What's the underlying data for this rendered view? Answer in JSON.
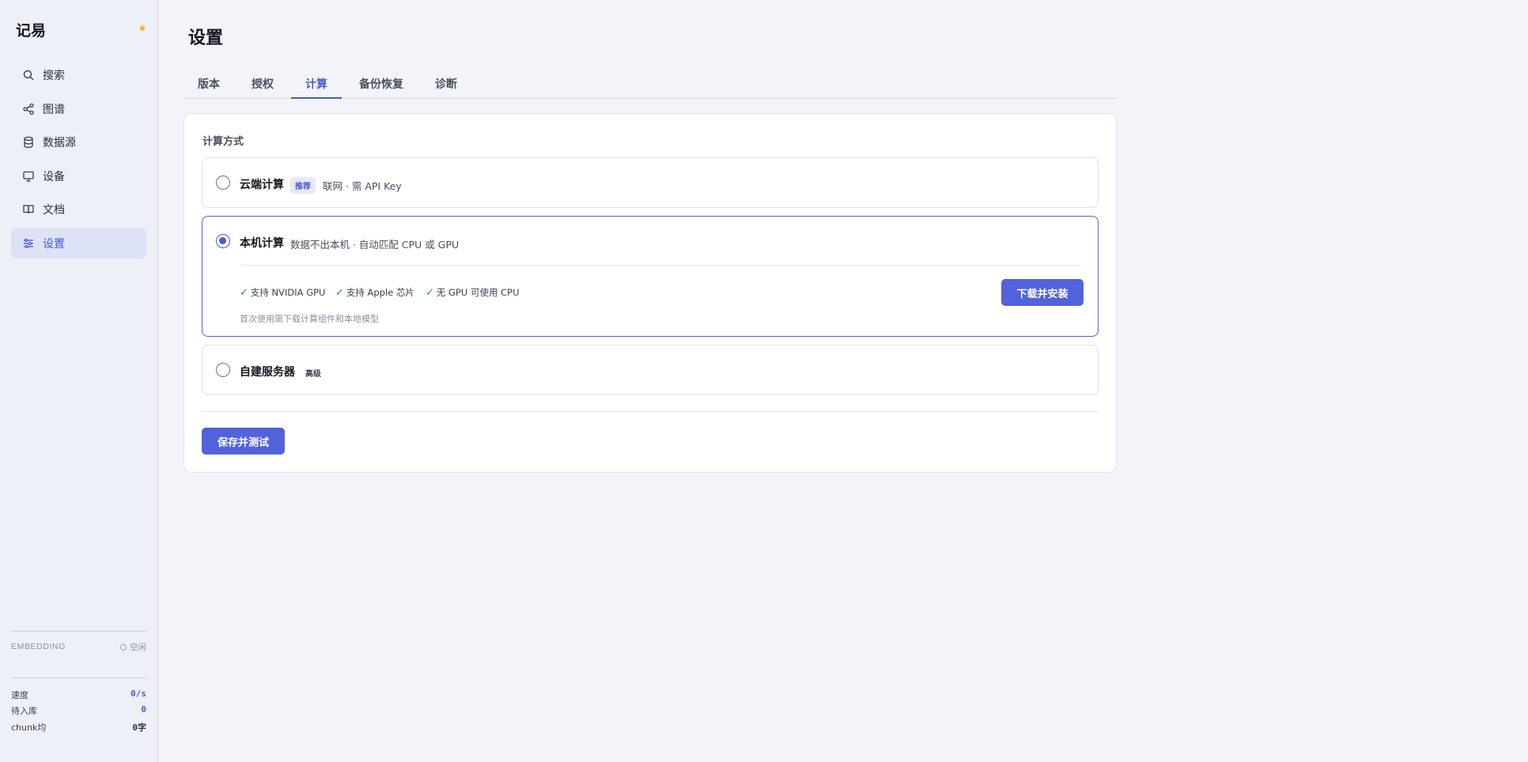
{
  "sidebar": {
    "brand": "记易",
    "items": [
      {
        "label": "搜索",
        "icon": "search-icon"
      },
      {
        "label": "图谱",
        "icon": "graph-icon"
      },
      {
        "label": "数据源",
        "icon": "database-icon"
      },
      {
        "label": "设备",
        "icon": "monitor-icon"
      },
      {
        "label": "文档",
        "icon": "book-icon"
      },
      {
        "label": "设置",
        "icon": "sliders-icon",
        "active": true
      }
    ],
    "embedding_label": "EMBEDDING",
    "embedding_status": "空闲",
    "stats": [
      {
        "label": "速度",
        "value": "0/s"
      },
      {
        "label": "待入库",
        "value": "0"
      },
      {
        "label": "chunk均",
        "value": "0字"
      }
    ]
  },
  "main": {
    "title": "设置",
    "tabs": [
      {
        "label": "版本"
      },
      {
        "label": "授权"
      },
      {
        "label": "计算",
        "active": true
      },
      {
        "label": "备份恢复"
      },
      {
        "label": "诊断"
      }
    ],
    "section_label": "计算方式",
    "options": {
      "cloud": {
        "title": "云端计算",
        "badge": "推荐",
        "desc": "联网 · 需 API Key"
      },
      "local": {
        "title": "本机计算",
        "desc": "数据不出本机 · 自动匹配 CPU 或 GPU",
        "features": [
          "支持 NVIDIA GPU",
          "支持 Apple 芯片",
          "无 GPU 可使用 CPU"
        ],
        "hint": "首次使用需下载计算组件和本地模型",
        "button": "下载并安装"
      },
      "server": {
        "title": "自建服务器",
        "badge": "高级"
      }
    },
    "save_button": "保存并测试"
  },
  "colors": {
    "accent": "#5162dc",
    "check": "#1f9a5a",
    "sidebar_bg": "#eef0f7",
    "page_bg": "#f3f4f9"
  }
}
